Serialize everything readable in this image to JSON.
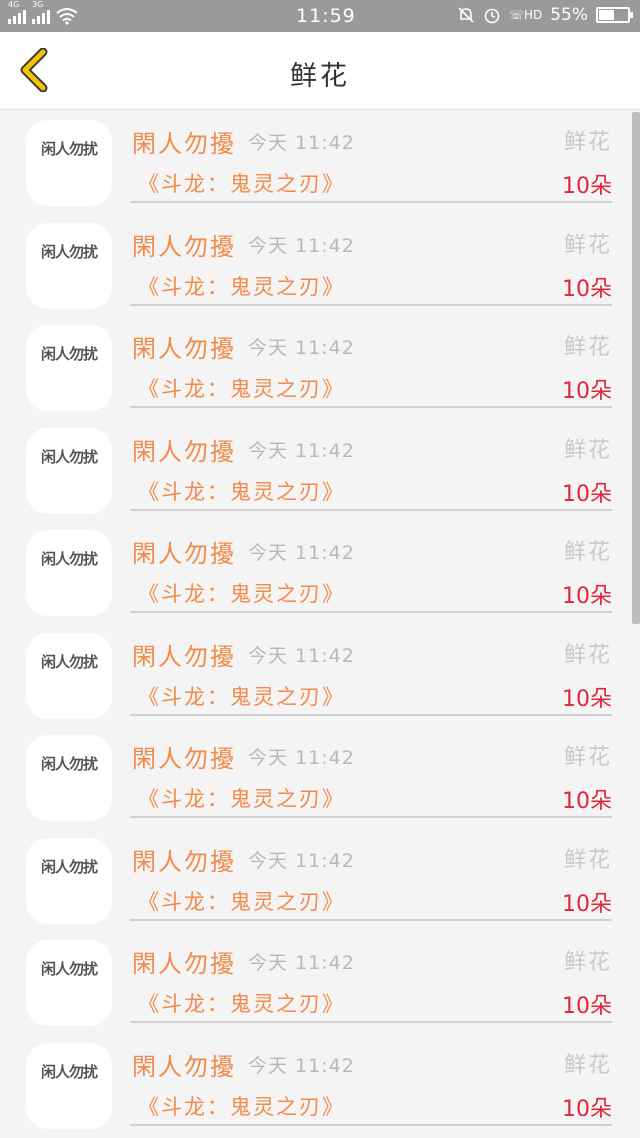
{
  "status_bar": {
    "net1": "4G",
    "net2": "3G",
    "time": "11:59",
    "battery_text": "55%",
    "battery_level": 0.55,
    "hd_label": "HD"
  },
  "nav": {
    "title": "鲜花",
    "accent_color": "#f5c400"
  },
  "items": [
    {
      "avatar_text": "闲人勿扰",
      "sender": "閑人勿擾",
      "time": "今天 11:42",
      "gift": "鲜花",
      "book": "《斗龙：鬼灵之刃》",
      "qty": "10朵"
    },
    {
      "avatar_text": "闲人勿扰",
      "sender": "閑人勿擾",
      "time": "今天 11:42",
      "gift": "鲜花",
      "book": "《斗龙：鬼灵之刃》",
      "qty": "10朵"
    },
    {
      "avatar_text": "闲人勿扰",
      "sender": "閑人勿擾",
      "time": "今天 11:42",
      "gift": "鲜花",
      "book": "《斗龙：鬼灵之刃》",
      "qty": "10朵"
    },
    {
      "avatar_text": "闲人勿扰",
      "sender": "閑人勿擾",
      "time": "今天 11:42",
      "gift": "鲜花",
      "book": "《斗龙：鬼灵之刃》",
      "qty": "10朵"
    },
    {
      "avatar_text": "闲人勿扰",
      "sender": "閑人勿擾",
      "time": "今天 11:42",
      "gift": "鲜花",
      "book": "《斗龙：鬼灵之刃》",
      "qty": "10朵"
    },
    {
      "avatar_text": "闲人勿扰",
      "sender": "閑人勿擾",
      "time": "今天 11:42",
      "gift": "鲜花",
      "book": "《斗龙：鬼灵之刃》",
      "qty": "10朵"
    },
    {
      "avatar_text": "闲人勿扰",
      "sender": "閑人勿擾",
      "time": "今天 11:42",
      "gift": "鲜花",
      "book": "《斗龙：鬼灵之刃》",
      "qty": "10朵"
    },
    {
      "avatar_text": "闲人勿扰",
      "sender": "閑人勿擾",
      "time": "今天 11:42",
      "gift": "鲜花",
      "book": "《斗龙：鬼灵之刃》",
      "qty": "10朵"
    },
    {
      "avatar_text": "闲人勿扰",
      "sender": "閑人勿擾",
      "time": "今天 11:42",
      "gift": "鲜花",
      "book": "《斗龙：鬼灵之刃》",
      "qty": "10朵"
    },
    {
      "avatar_text": "闲人勿扰",
      "sender": "閑人勿擾",
      "time": "今天 11:42",
      "gift": "鲜花",
      "book": "《斗龙：鬼灵之刃》",
      "qty": "10朵"
    }
  ],
  "colors": {
    "sender": "#f28b4a",
    "quantity": "#e0263b",
    "muted": "#b8b8b8"
  }
}
